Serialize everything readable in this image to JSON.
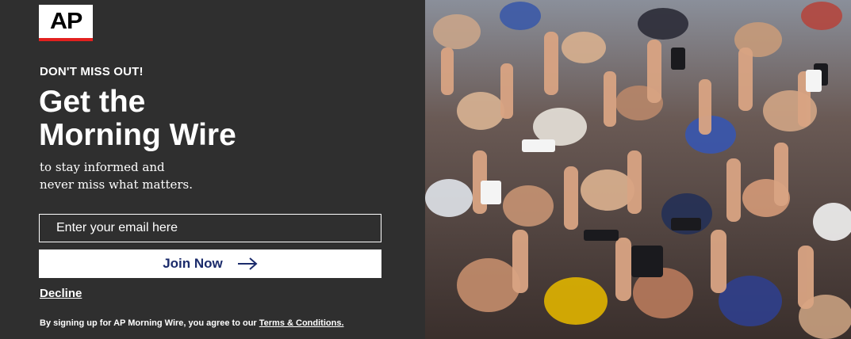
{
  "brand": {
    "logo_text": "AP",
    "accent": "#e2201f"
  },
  "promo": {
    "eyebrow": "DON'T MISS OUT!",
    "headline_line1": "Get the",
    "headline_line2": "Morning Wire",
    "subline_line1": "to stay informed and",
    "subline_line2": "never miss what matters."
  },
  "form": {
    "email_placeholder": "Enter your email here",
    "join_label": "Join Now",
    "decline_label": "Decline"
  },
  "legal": {
    "prefix": "By signing up for AP Morning Wire, you agree to our ",
    "terms_link": "Terms & Conditions."
  },
  "colors": {
    "panel_bg": "#2f2f2f",
    "button_text": "#1b2b6b",
    "text": "#ffffff"
  },
  "photo": {
    "subject": "crowd-raised-hands"
  }
}
